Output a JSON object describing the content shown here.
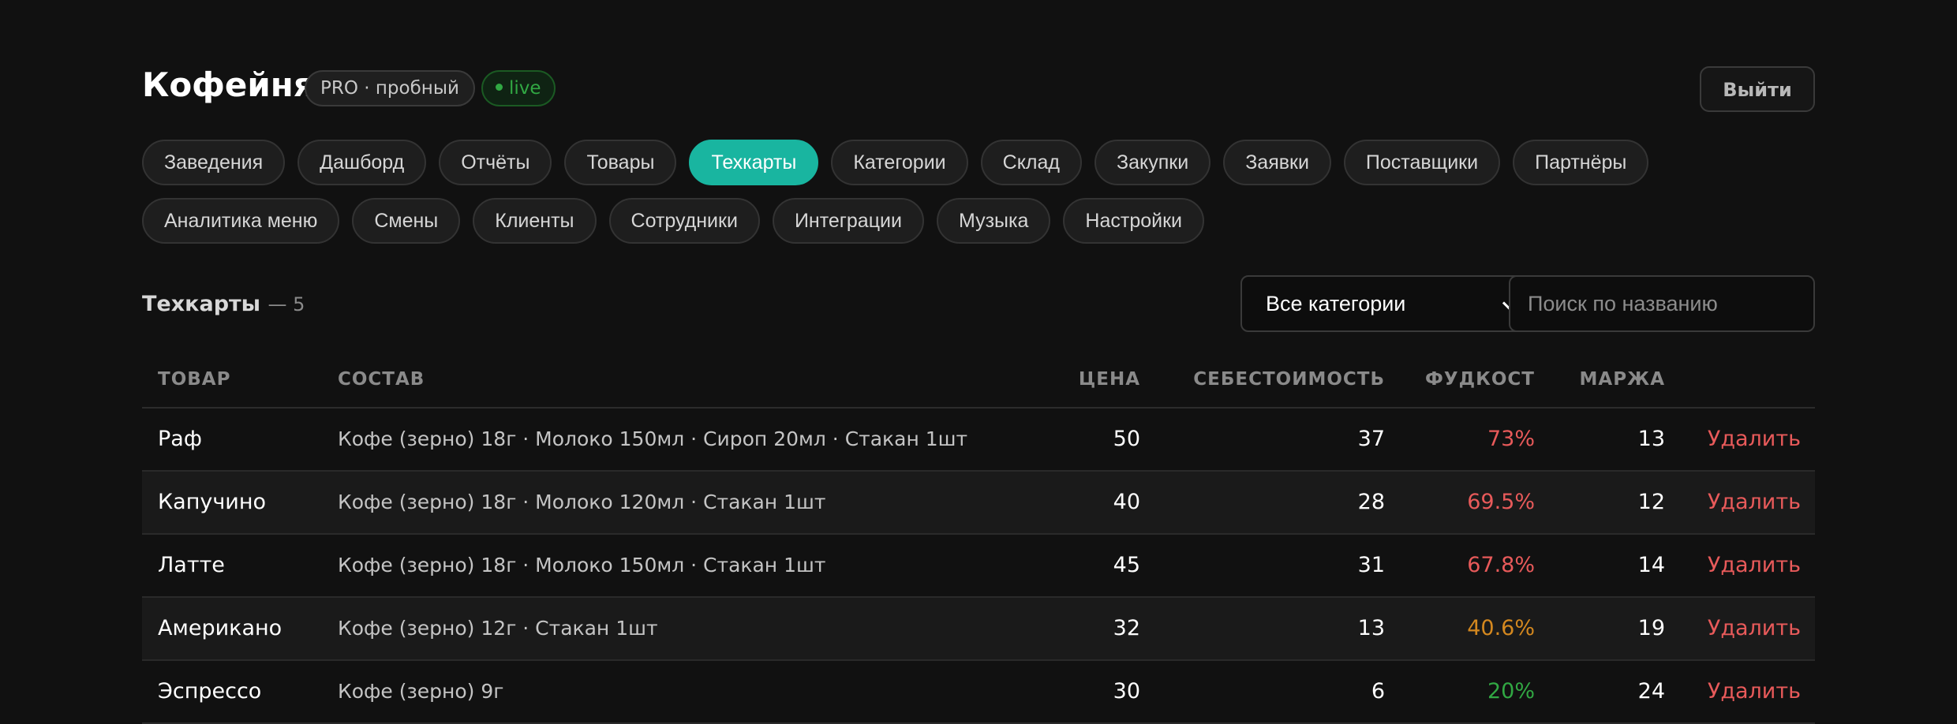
{
  "header": {
    "title": "Кофейня",
    "plan_badge": "PRO · пробный",
    "live_badge": "live",
    "logout_label": "Выйти"
  },
  "colors": {
    "accent": "#19b5a0",
    "danger": "#e85a5a",
    "warning": "#d4881f",
    "ok": "#31a843"
  },
  "nav": {
    "items": [
      {
        "label": "Заведения",
        "active": false
      },
      {
        "label": "Дашборд",
        "active": false
      },
      {
        "label": "Отчёты",
        "active": false
      },
      {
        "label": "Товары",
        "active": false
      },
      {
        "label": "Техкарты",
        "active": true
      },
      {
        "label": "Категории",
        "active": false
      },
      {
        "label": "Склад",
        "active": false
      },
      {
        "label": "Закупки",
        "active": false
      },
      {
        "label": "Заявки",
        "active": false
      },
      {
        "label": "Поставщики",
        "active": false
      },
      {
        "label": "Партнёры",
        "active": false
      },
      {
        "label": "Аналитика меню",
        "active": false
      },
      {
        "label": "Смены",
        "active": false
      },
      {
        "label": "Клиенты",
        "active": false
      },
      {
        "label": "Сотрудники",
        "active": false
      },
      {
        "label": "Интеграции",
        "active": false
      },
      {
        "label": "Музыка",
        "active": false
      },
      {
        "label": "Настройки",
        "active": false
      }
    ]
  },
  "section": {
    "title": "Техкарты",
    "count": "— 5"
  },
  "filters": {
    "category_selected": "Все категории",
    "search_placeholder": "Поиск по названию"
  },
  "table": {
    "columns": {
      "name": "ТОВАР",
      "composition": "СОСТАВ",
      "price": "ЦЕНА",
      "cost": "СЕБЕСТОИМОСТЬ",
      "foodcost": "ФУДКОСТ",
      "margin": "МАРЖА"
    },
    "delete_label": "Удалить",
    "rows": [
      {
        "name": "Раф",
        "composition": "Кофе (зерно) 18г · Молоко 150мл · Сироп 20мл · Стакан 1шт",
        "price": "50",
        "cost": "37",
        "foodcost": "73%",
        "foodcost_color": "#e85a5a",
        "margin": "13"
      },
      {
        "name": "Капучино",
        "composition": "Кофе (зерно) 18г · Молоко 120мл · Стакан 1шт",
        "price": "40",
        "cost": "28",
        "foodcost": "69.5%",
        "foodcost_color": "#e85a5a",
        "margin": "12"
      },
      {
        "name": "Латте",
        "composition": "Кофе (зерно) 18г · Молоко 150мл · Стакан 1шт",
        "price": "45",
        "cost": "31",
        "foodcost": "67.8%",
        "foodcost_color": "#e85a5a",
        "margin": "14"
      },
      {
        "name": "Американо",
        "composition": "Кофе (зерно) 12г · Стакан 1шт",
        "price": "32",
        "cost": "13",
        "foodcost": "40.6%",
        "foodcost_color": "#d4881f",
        "margin": "19"
      },
      {
        "name": "Эспрессо",
        "composition": "Кофе (зерно) 9г",
        "price": "30",
        "cost": "6",
        "foodcost": "20%",
        "foodcost_color": "#31a843",
        "margin": "24"
      }
    ]
  }
}
